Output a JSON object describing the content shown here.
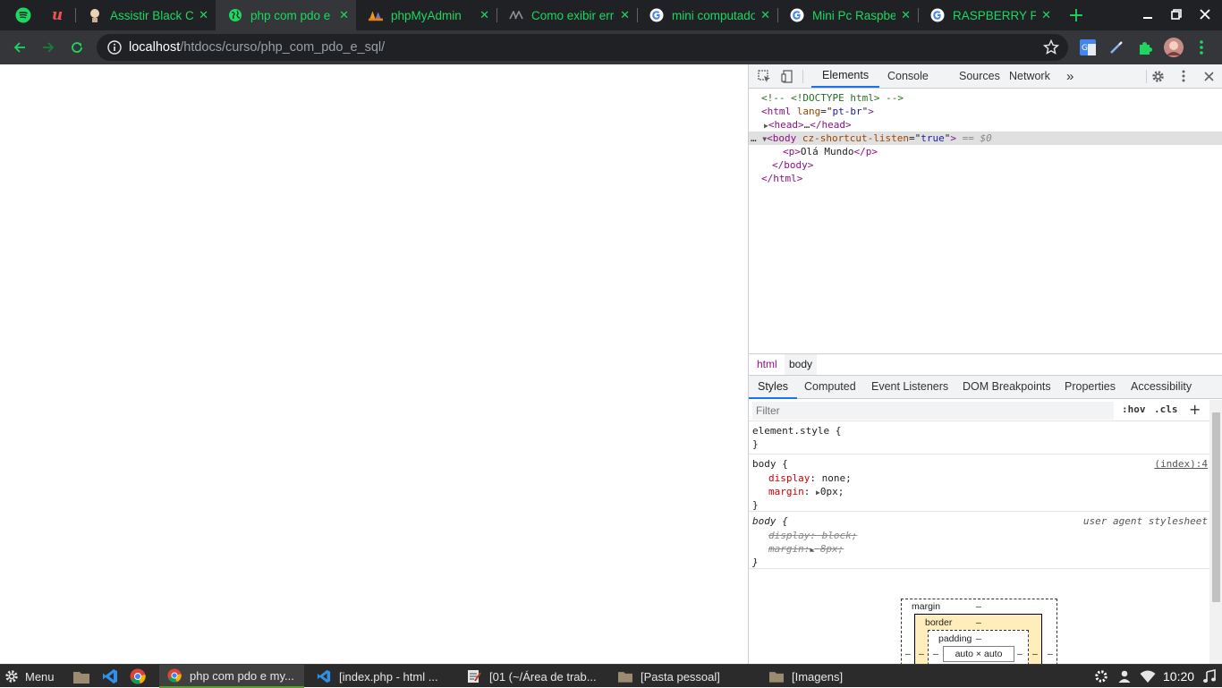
{
  "browser": {
    "tabs": [
      {
        "title": "Assistir Black Cl",
        "icon": "avatar-face-icon"
      },
      {
        "title": "php com pdo e sql",
        "icon": "globe-icon"
      },
      {
        "title": "phpMyAdmin",
        "icon": "phpmyadmin-icon"
      },
      {
        "title": "Como exibir erro",
        "icon": "site-logo-icon"
      },
      {
        "title": "mini computador",
        "icon": "google-icon"
      },
      {
        "title": "Mini Pc Raspberry",
        "icon": "google-icon"
      },
      {
        "title": "RASPBERRY PI",
        "icon": "google-icon"
      }
    ],
    "tab_close_glyph": "✕",
    "new_tab_glyph": "+",
    "url_host": "localhost",
    "url_path": "/htdocs/curso/php_com_pdo_e_sql/"
  },
  "devtools": {
    "tabs": [
      "Elements",
      "Console",
      "Sources",
      "Network"
    ],
    "more_glyph": "»",
    "dom": {
      "comment": "<!-- <!DOCTYPE html> -->",
      "html_open_tag": "html",
      "html_attr_name": "lang",
      "html_attr_value": "pt-br",
      "head_tag": "head",
      "ellipsis": "…",
      "body_tag": "body",
      "body_attr_name": "cz-shortcut-listen",
      "body_attr_value": "true",
      "body_suffix": "== $0",
      "p_tag": "p",
      "p_text": "Olá Mundo"
    },
    "breadcrumbs": [
      "html",
      "body"
    ],
    "subtabs": [
      "Styles",
      "Computed",
      "Event Listeners",
      "DOM Breakpoints",
      "Properties",
      "Accessibility"
    ],
    "styles": {
      "filter_placeholder": "Filter",
      "hov": ":hov",
      "cls": ".cls",
      "add_glyph": "+",
      "element_style": "element.style {",
      "close_brace": "}",
      "rule1_selector": "body {",
      "rule1_source": "(index):4",
      "rule1_prop1": "display",
      "rule1_val1": "none;",
      "rule1_prop2": "margin",
      "rule1_val2": "0px;",
      "rule2_selector": "body {",
      "rule2_source": "user agent stylesheet",
      "rule2_line1": "display: block;",
      "rule2_prop2": "margin:",
      "rule2_val2": "8px;"
    },
    "box_model": {
      "margin_label": "margin",
      "border_label": "border",
      "padding_label": "padding",
      "dash": "–",
      "content": "auto × auto"
    }
  },
  "taskbar": {
    "menu_label": "Menu",
    "items": [
      {
        "label": "php com pdo e my...",
        "icon": "chrome-icon"
      },
      {
        "label": "[index.php - html ...",
        "icon": "vscode-icon"
      },
      {
        "label": "[01 (~/Área de trab...",
        "icon": "text-editor-icon"
      },
      {
        "label": "[Pasta pessoal]",
        "icon": "folder-icon"
      },
      {
        "label": "[Imagens]",
        "icon": "folder-icon"
      }
    ],
    "clock": "10:20"
  },
  "colors": {
    "tab_text": "#1ed760",
    "chrome_dark": "#202124",
    "toolbar": "#35363a",
    "devtools_accent": "#1a73e8"
  }
}
